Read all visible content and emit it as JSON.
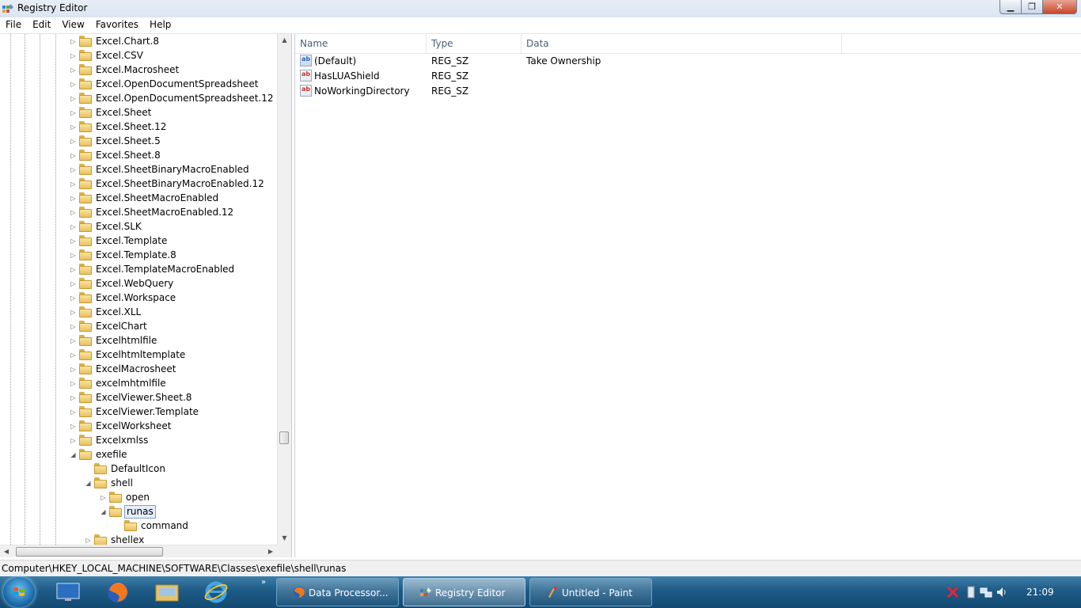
{
  "window": {
    "title": "Registry Editor"
  },
  "menu": [
    "File",
    "Edit",
    "View",
    "Favorites",
    "Help"
  ],
  "tree": {
    "items": [
      {
        "label": "Excel.Chart.8",
        "level": 0,
        "expander": "collapsed"
      },
      {
        "label": "Excel.CSV",
        "level": 0,
        "expander": "collapsed"
      },
      {
        "label": "Excel.Macrosheet",
        "level": 0,
        "expander": "collapsed"
      },
      {
        "label": "Excel.OpenDocumentSpreadsheet",
        "level": 0,
        "expander": "collapsed"
      },
      {
        "label": "Excel.OpenDocumentSpreadsheet.12",
        "level": 0,
        "expander": "collapsed"
      },
      {
        "label": "Excel.Sheet",
        "level": 0,
        "expander": "collapsed"
      },
      {
        "label": "Excel.Sheet.12",
        "level": 0,
        "expander": "collapsed"
      },
      {
        "label": "Excel.Sheet.5",
        "level": 0,
        "expander": "collapsed"
      },
      {
        "label": "Excel.Sheet.8",
        "level": 0,
        "expander": "collapsed"
      },
      {
        "label": "Excel.SheetBinaryMacroEnabled",
        "level": 0,
        "expander": "collapsed"
      },
      {
        "label": "Excel.SheetBinaryMacroEnabled.12",
        "level": 0,
        "expander": "collapsed"
      },
      {
        "label": "Excel.SheetMacroEnabled",
        "level": 0,
        "expander": "collapsed"
      },
      {
        "label": "Excel.SheetMacroEnabled.12",
        "level": 0,
        "expander": "collapsed"
      },
      {
        "label": "Excel.SLK",
        "level": 0,
        "expander": "collapsed"
      },
      {
        "label": "Excel.Template",
        "level": 0,
        "expander": "collapsed"
      },
      {
        "label": "Excel.Template.8",
        "level": 0,
        "expander": "collapsed"
      },
      {
        "label": "Excel.TemplateMacroEnabled",
        "level": 0,
        "expander": "collapsed"
      },
      {
        "label": "Excel.WebQuery",
        "level": 0,
        "expander": "collapsed"
      },
      {
        "label": "Excel.Workspace",
        "level": 0,
        "expander": "collapsed"
      },
      {
        "label": "Excel.XLL",
        "level": 0,
        "expander": "collapsed"
      },
      {
        "label": "ExcelChart",
        "level": 0,
        "expander": "collapsed"
      },
      {
        "label": "Excelhtmlfile",
        "level": 0,
        "expander": "collapsed"
      },
      {
        "label": "Excelhtmltemplate",
        "level": 0,
        "expander": "collapsed"
      },
      {
        "label": "ExcelMacrosheet",
        "level": 0,
        "expander": "collapsed"
      },
      {
        "label": "excelmhtmlfile",
        "level": 0,
        "expander": "collapsed"
      },
      {
        "label": "ExcelViewer.Sheet.8",
        "level": 0,
        "expander": "collapsed"
      },
      {
        "label": "ExcelViewer.Template",
        "level": 0,
        "expander": "collapsed"
      },
      {
        "label": "ExcelWorksheet",
        "level": 0,
        "expander": "collapsed"
      },
      {
        "label": "Excelxmlss",
        "level": 0,
        "expander": "collapsed"
      },
      {
        "label": "exefile",
        "level": 0,
        "expander": "expanded"
      },
      {
        "label": "DefaultIcon",
        "level": 1,
        "expander": "none"
      },
      {
        "label": "shell",
        "level": 1,
        "expander": "expanded"
      },
      {
        "label": "open",
        "level": 2,
        "expander": "collapsed"
      },
      {
        "label": "runas",
        "level": 2,
        "expander": "expanded",
        "selected": true
      },
      {
        "label": "command",
        "level": 3,
        "expander": "none"
      },
      {
        "label": "shellex",
        "level": 1,
        "expander": "collapsed"
      }
    ]
  },
  "values": {
    "columns": [
      "Name",
      "Type",
      "Data"
    ],
    "rows": [
      {
        "name": "(Default)",
        "type": "REG_SZ",
        "data": "Take Ownership",
        "icon": "default"
      },
      {
        "name": "HasLUAShield",
        "type": "REG_SZ",
        "data": "",
        "icon": "string"
      },
      {
        "name": "NoWorkingDirectory",
        "type": "REG_SZ",
        "data": "",
        "icon": "string"
      }
    ]
  },
  "status": {
    "path": "Computer\\HKEY_LOCAL_MACHINE\\SOFTWARE\\Classes\\exefile\\shell\\runas"
  },
  "taskbar": {
    "tasks": [
      {
        "label": "Data Processor...",
        "icon": "firefox-icon",
        "active": false
      },
      {
        "label": "Registry Editor",
        "icon": "regedit-icon",
        "active": true
      },
      {
        "label": "Untitled - Paint",
        "icon": "paint-icon",
        "active": false
      }
    ],
    "pinned": [
      "explorer-desktop-icon",
      "firefox-icon",
      "windows-explorer-icon",
      "internet-explorer-icon"
    ],
    "clock": "21:09"
  }
}
